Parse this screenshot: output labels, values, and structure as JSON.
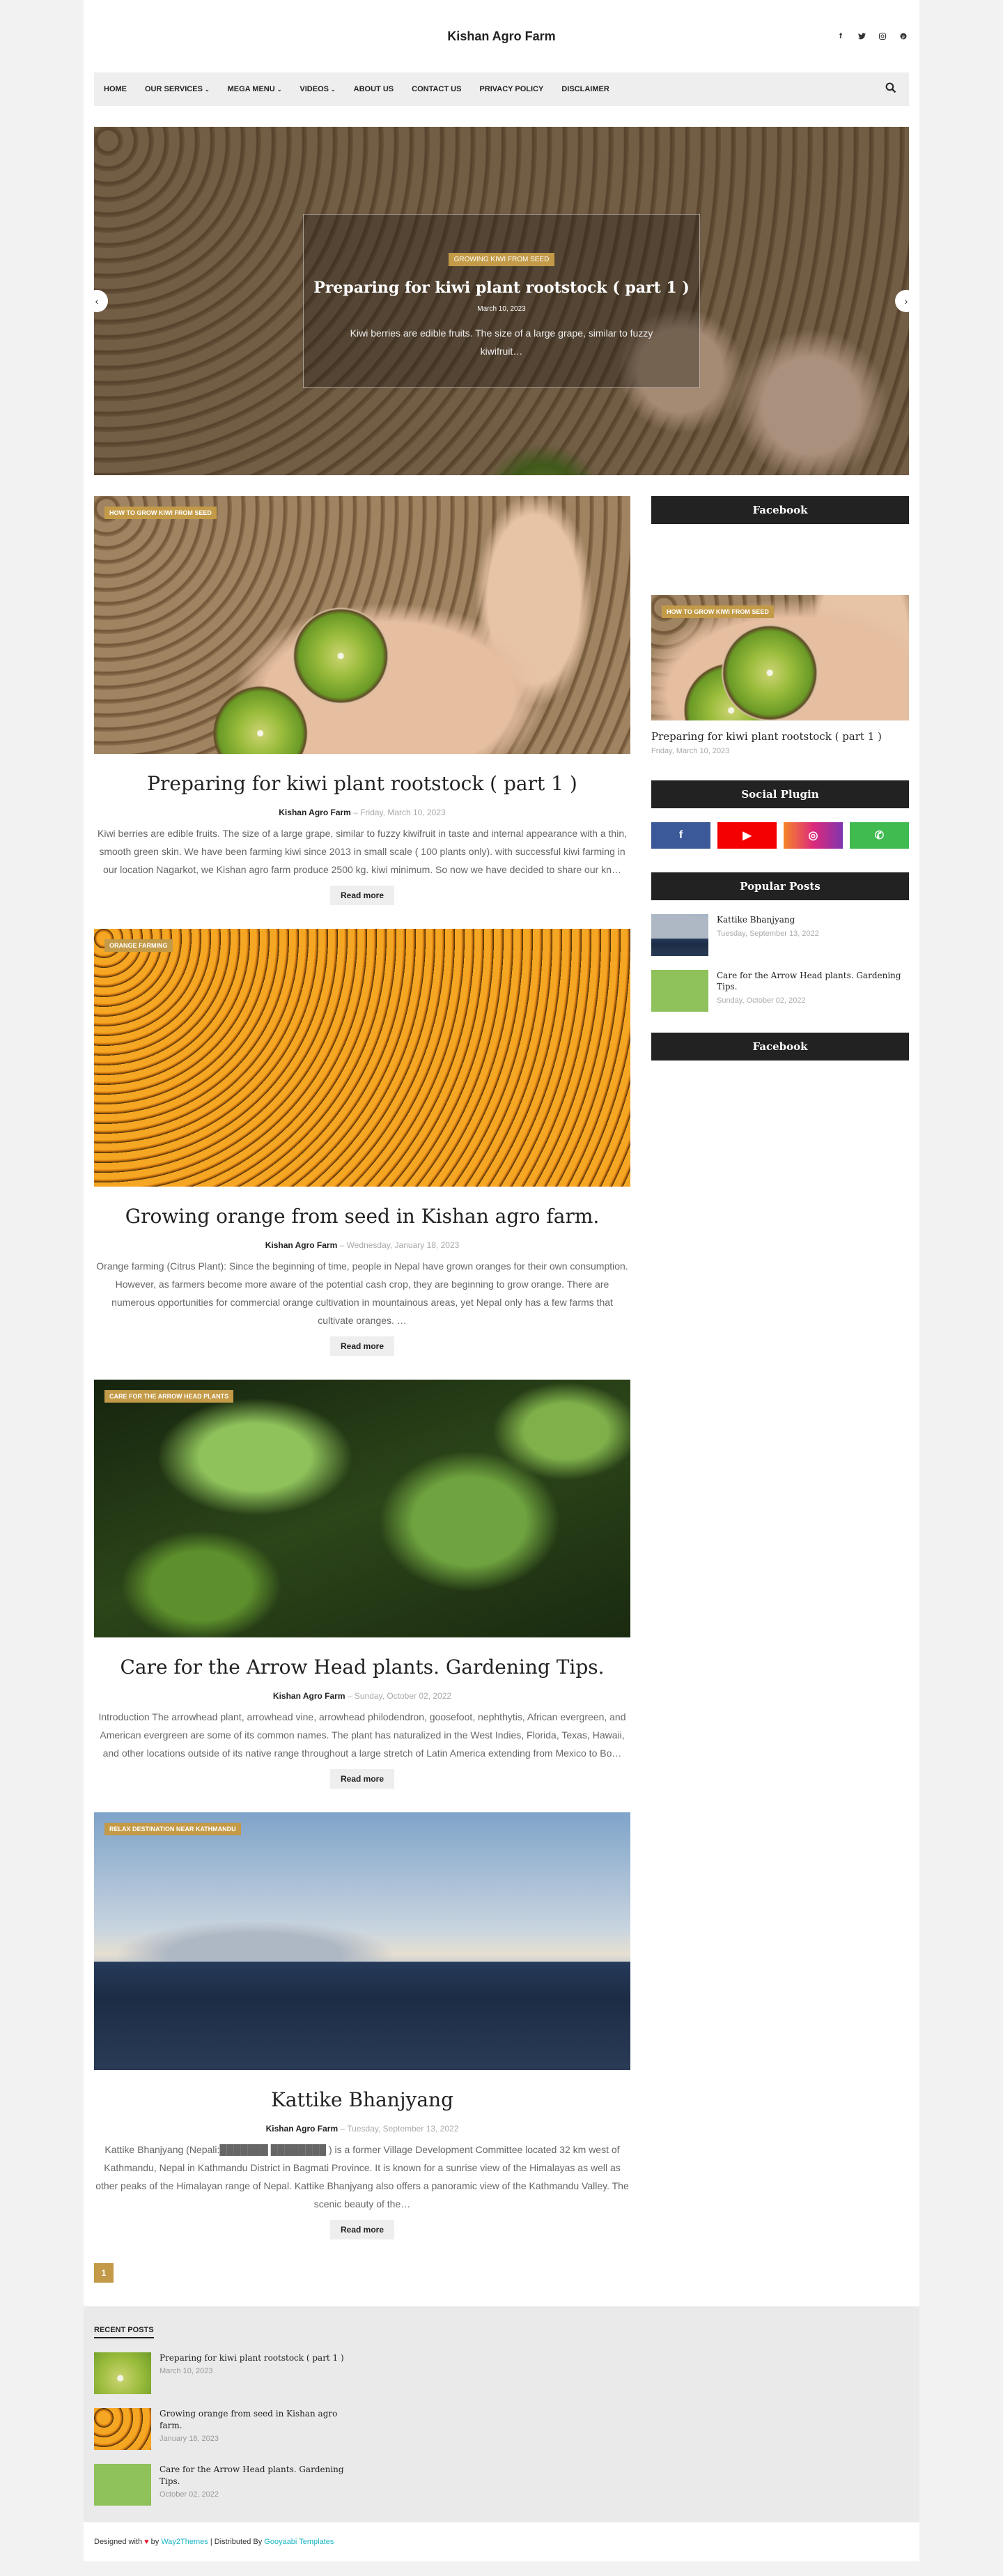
{
  "header": {
    "site_title": "Kishan Agro Farm",
    "social_icons": [
      "facebook-icon",
      "twitter-icon",
      "instagram-icon",
      "pinterest-icon"
    ]
  },
  "nav": {
    "items": [
      {
        "label": "HOME",
        "dropdown": false
      },
      {
        "label": "OUR SERVICES",
        "dropdown": true
      },
      {
        "label": "MEGA MENU",
        "dropdown": true
      },
      {
        "label": "VIDEOS",
        "dropdown": true
      },
      {
        "label": "ABOUT US",
        "dropdown": false
      },
      {
        "label": "CONTACT US",
        "dropdown": false
      },
      {
        "label": "PRIVACY POLICY",
        "dropdown": false
      },
      {
        "label": "DISCLAIMER",
        "dropdown": false
      }
    ]
  },
  "slider": {
    "tag": "GROWING KIWI FROM SEED",
    "title": "Preparing for kiwi plant rootstock ( part 1 )",
    "date": "March 10, 2023",
    "excerpt": "Kiwi berries are edible fruits. The size of a large grape, similar to fuzzy kiwifruit…"
  },
  "posts": [
    {
      "tag": "HOW TO GROW KIWI FROM SEED",
      "title": "Preparing for kiwi plant rootstock ( part 1 )",
      "author": "Kishan Agro Farm",
      "date": "Friday, March 10, 2023",
      "excerpt": "Kiwi berries are edible fruits. The size of a large grape, similar to fuzzy kiwifruit in taste and internal appearance with a thin, smooth green skin. We have been farming kiwi since 2013 in small scale ( 100 plants only). with successful kiwi farming in our location Nagarkot, we Kishan agro farm produce 2500 kg. kiwi minimum. So now we have decided to share our kn…",
      "read_more": "Read more"
    },
    {
      "tag": "ORANGE FARMING",
      "title": "Growing orange from seed in Kishan agro farm.",
      "author": "Kishan Agro Farm",
      "date": "Wednesday, January 18, 2023",
      "excerpt": "Orange farming (Citrus Plant): Since the beginning of time, people in Nepal have grown oranges for their own consumption. However, as farmers become more aware of the potential cash crop, they are beginning to grow orange. There are numerous opportunities for commercial orange cultivation in mountainous areas, yet Nepal only has a few farms that cultivate oranges. …",
      "read_more": "Read more"
    },
    {
      "tag": "CARE FOR THE ARROW HEAD PLANTS",
      "title": "Care for the Arrow Head plants. Gardening Tips.",
      "author": "Kishan Agro Farm",
      "date": "Sunday, October 02, 2022",
      "excerpt": "Introduction        The arrowhead plant, arrowhead vine, arrowhead philodendron, goosefoot, nephthytis, African evergreen, and American evergreen are some of its common names. The plant has naturalized in the West Indies, Florida, Texas, Hawaii, and other locations outside of its native range throughout a large stretch of Latin America extending from Mexico to Bo…",
      "read_more": "Read more"
    },
    {
      "tag": "RELAX DESTINATION NEAR KATHMANDU",
      "title": "Kattike Bhanjyang",
      "author": "Kishan Agro Farm",
      "date": "Tuesday, September 13, 2022",
      "excerpt": "Kattike Bhanjyang (Nepali:███████ ████████ ) is a former Village Development Committee located 32 km west of Kathmandu, Nepal in Kathmandu District in Bagmati Province. It is known for a sunrise view of the Himalayas as well as other peaks of the Himalayan range of Nepal. Kattike Bhanjyang also offers a panoramic view of the Kathmandu Valley. The scenic beauty of the…",
      "read_more": "Read more"
    }
  ],
  "pagination": {
    "current": "1"
  },
  "sidebar": {
    "facebook_title": "Facebook",
    "featured": {
      "tag": "HOW TO GROW KIWI FROM SEED",
      "title": "Preparing for kiwi plant rootstock ( part 1 )",
      "date": "Friday, March 10, 2023"
    },
    "social_title": "Social Plugin",
    "social_buttons": [
      {
        "icon": "facebook-icon",
        "glyph": "f",
        "color": "#3b5998"
      },
      {
        "icon": "youtube-icon",
        "glyph": "▶",
        "color": "#f50000"
      },
      {
        "icon": "instagram-icon",
        "glyph": "◎",
        "color": "#c536a4"
      },
      {
        "icon": "whatsapp-icon",
        "glyph": "✆",
        "color": "#3fbb50"
      }
    ],
    "popular_title": "Popular Posts",
    "popular": [
      {
        "title": "Kattike Bhanjyang",
        "date": "Tuesday, September 13, 2022"
      },
      {
        "title": "Care for the Arrow Head plants. Gardening Tips.",
        "date": "Sunday, October 02, 2022"
      }
    ],
    "facebook_title_2": "Facebook"
  },
  "footer": {
    "recent_title": "RECENT POSTS",
    "recent": [
      {
        "title": "Preparing for kiwi plant rootstock ( part 1 )",
        "date": "March 10, 2023"
      },
      {
        "title": "Growing orange from seed in Kishan agro farm.",
        "date": "January 18, 2023"
      },
      {
        "title": "Care for the Arrow Head plants. Gardening Tips.",
        "date": "October 02, 2022"
      }
    ],
    "designed_with": "Designed with",
    "by": "by",
    "theme_author": "Way2Themes",
    "distributed_by": "| Distributed By",
    "distributor": "Gooyaabi Templates"
  },
  "colors": {
    "accent": "#c39a47",
    "dark": "#222222",
    "link": "#1ab5c5"
  }
}
